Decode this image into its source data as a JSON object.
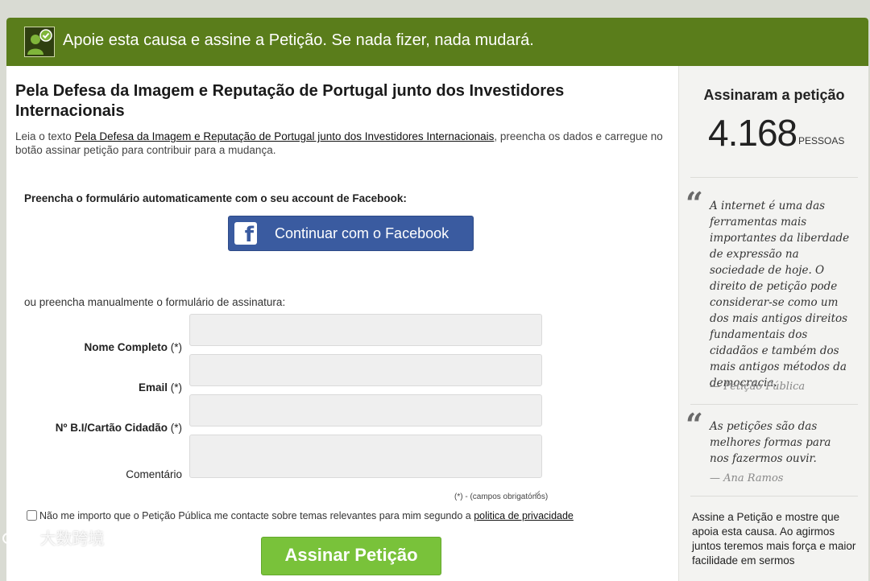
{
  "banner": {
    "text": "Apoie esta causa e assine a Petição. Se nada fizer, nada mudará.",
    "icon": "petition-person-check-icon"
  },
  "petition": {
    "title": "Pela Defesa da Imagem e Reputação de Portugal junto dos Investidores Internacionais",
    "intro_prefix": "Leia o texto ",
    "intro_link": "Pela Defesa da Imagem e Reputação de Portugal junto dos Investidores Internacionais",
    "intro_suffix": ", preencha os dados e carregue no botão assinar petição para contribuir para a mudança."
  },
  "facebook": {
    "label": "Preencha o formulário automaticamente com o seu account de Facebook:",
    "button_label": "Continuar com o Facebook",
    "icon": "facebook-icon",
    "color": "#3a5ba0"
  },
  "form": {
    "manual_label": "ou preencha manualmente o formulário de assinatura:",
    "fields": [
      {
        "label": "Nome Completo",
        "required_mark": "(*)",
        "value": ""
      },
      {
        "label": "Email",
        "required_mark": "(*)",
        "value": ""
      },
      {
        "label": "Nº B.I/Cartão Cidadão",
        "required_mark": "(*)",
        "value": ""
      },
      {
        "label": "Comentário",
        "required_mark": "",
        "value": ""
      }
    ],
    "required_note": "(*) - (campos obrigatórios)",
    "consent_text": "Não me importo que o Petição Pública me contacte sobre temas relevantes para mim segundo a ",
    "consent_link": "politica de privacidade",
    "consent_checked": false,
    "submit_label": "Assinar Petição",
    "submit_color": "#79c23a"
  },
  "sidebar": {
    "count_title": "Assinaram a petição",
    "count_number": "4.168",
    "count_unit": "PESSOAS",
    "quotes": [
      {
        "mark": "“",
        "text": "A internet é uma das ferramentas mais importantes da liberdade de expressão na sociedade de hoje. O direito de petição pode considerar-se como um dos mais antigos direitos fundamentais dos cidadãos e também dos mais antigos métodos da democracia.",
        "author": "— Petição Pública"
      },
      {
        "mark": "“",
        "text": "As petições são das melhores formas para nos fazermos ouvir.",
        "author": "— Ana Ramos"
      }
    ],
    "closing_text": "Assine a Petição e mostre que apoia esta causa. Ao agirmos juntos teremos mais força e maior facilidade em sermos"
  },
  "watermark": {
    "text": "大数跨境"
  },
  "theme": {
    "banner_green": "#5a7d1b",
    "sidebar_bg": "#f3f3f1"
  }
}
